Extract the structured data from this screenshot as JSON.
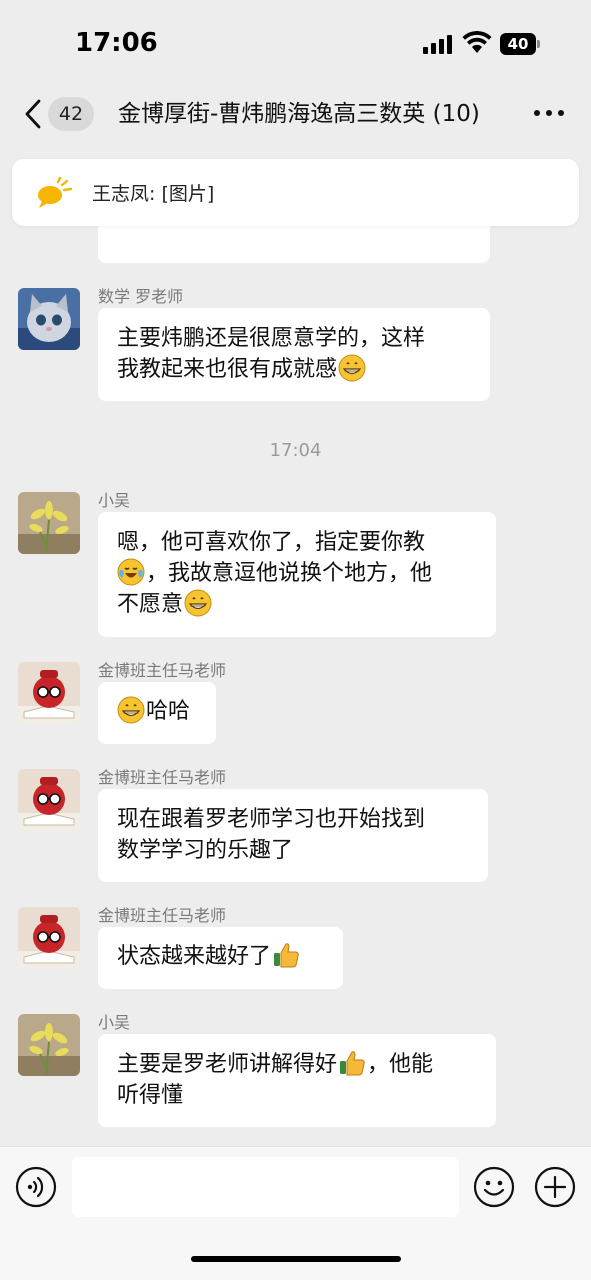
{
  "status_bar": {
    "time": "17:06",
    "battery": "40"
  },
  "header": {
    "unread_count": "42",
    "title": "金博厚街-曹炜鹏海逸高三数英 (10)"
  },
  "pinned": {
    "text": "王志凤: [图片]"
  },
  "colors": {
    "background": "#ededed",
    "bubble": "#ffffff",
    "sender_text": "#7a7a7a"
  },
  "messages": [
    {
      "sender": "数学 罗老师",
      "lines": [
        "主要炜鹏还是很愿意学的，这样",
        "我教起来也很有成就感"
      ],
      "trailing_emoji": "grin-emoji"
    },
    {
      "timestamp": "17:04"
    },
    {
      "sender": "小吴",
      "lines": [
        "嗯，他可喜欢你了，指定要你教",
        "，我故意逗他说换个地方，他",
        "不愿意"
      ],
      "emoji": [
        "tears-of-joy-emoji",
        "grin-emoji"
      ]
    },
    {
      "sender": "金博班主任马老师",
      "text": "哈哈",
      "leading_emoji": "grin-emoji"
    },
    {
      "sender": "金博班主任马老师",
      "lines": [
        "现在跟着罗老师学习也开始找到",
        "数学学习的乐趣了"
      ]
    },
    {
      "sender": "金博班主任马老师",
      "text": "状态越来越好了",
      "trailing_emoji": "thumbs-up-emoji"
    },
    {
      "sender": "小吴",
      "lines": [
        "主要是罗老师讲解得好",
        "，他能",
        "听得懂"
      ],
      "emoji": [
        "thumbs-up-emoji"
      ]
    }
  ],
  "input_bar": {
    "placeholder": ""
  }
}
